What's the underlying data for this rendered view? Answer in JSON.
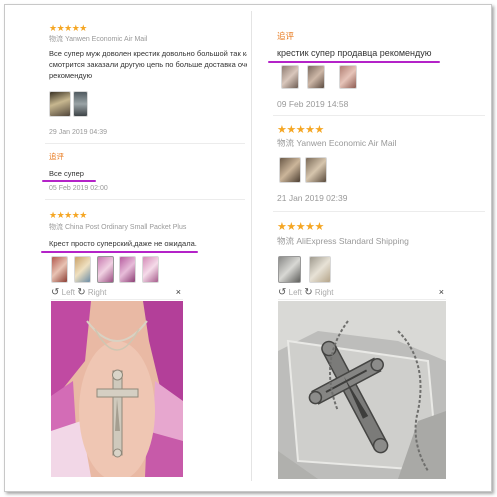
{
  "left": {
    "review1": {
      "stars": "★★★★★",
      "shipping_label": "物流",
      "shipping": "Yanwen Economic Air Mail",
      "text_line1": "Все супер муж доволен крестик довольно большой так как он и хо",
      "text_line2": "смотрится заказали другую цепь по больше доставка очень быстр",
      "text_line3": "рекомендую",
      "date": "29 Jan 2019 04:39"
    },
    "append1": {
      "label": "追评",
      "text": "Все супер",
      "date": "05 Feb 2019 02:00"
    },
    "review2": {
      "stars": "★★★★★",
      "shipping_label": "物流",
      "shipping": "China Post Ordinary Small Packet Plus",
      "text": "Крест просто суперский,даже не ожидала."
    },
    "viewer": {
      "left": "Left",
      "right": "Right",
      "close": "×"
    }
  },
  "right": {
    "append": {
      "label": "追评",
      "text": "крестик супер продавца рекомендую",
      "date": "09 Feb 2019 14:58"
    },
    "review1": {
      "stars": "★★★★★",
      "shipping_label": "物流",
      "shipping": "Yanwen Economic Air Mail",
      "date": "21 Jan 2019 02:39"
    },
    "review2": {
      "stars": "★★★★★",
      "shipping_label": "物流",
      "shipping": "AliExpress Standard Shipping"
    },
    "viewer": {
      "left": "Left",
      "right": "Right",
      "close": "×"
    }
  },
  "colors": {
    "star": "#f5a623",
    "underline": "#b423c8",
    "append_label": "#e87a1e"
  },
  "icons": [
    "rotate-left-icon",
    "rotate-right-icon",
    "close-icon",
    "star-icon"
  ]
}
